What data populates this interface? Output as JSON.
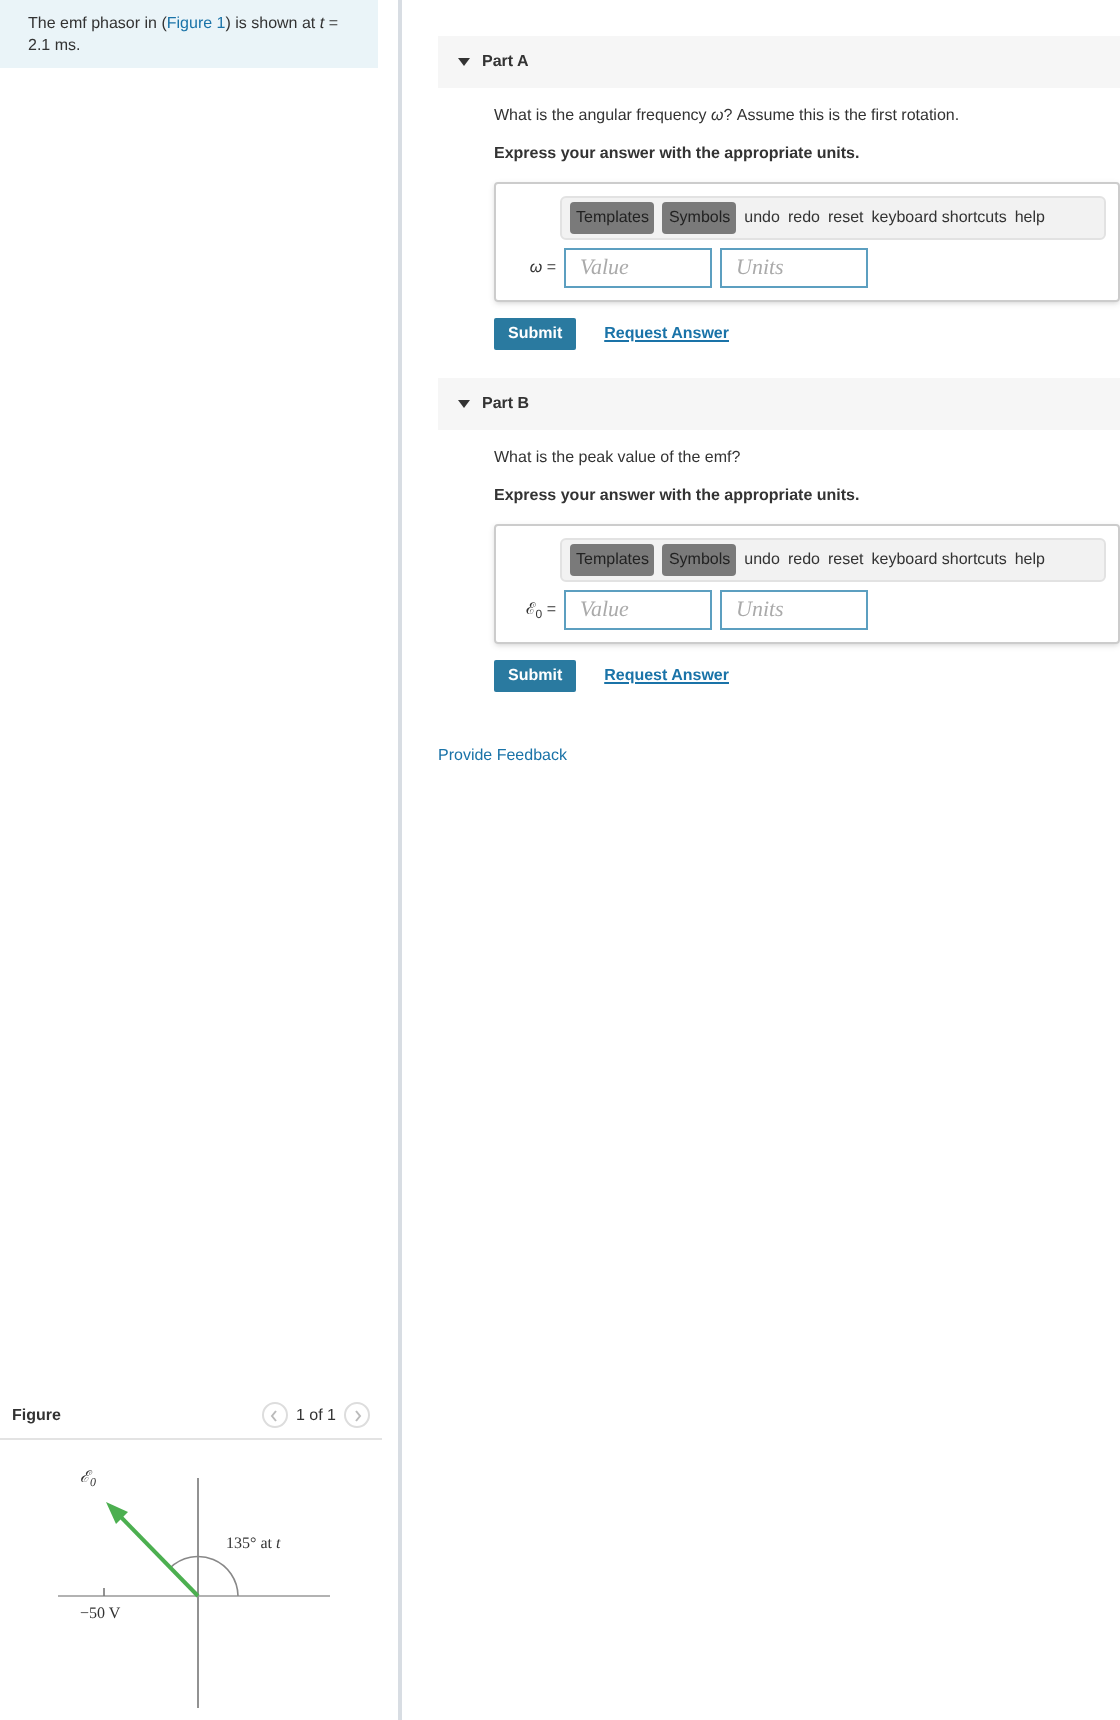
{
  "intro": {
    "before": "The emf phasor in (",
    "link": "Figure 1",
    "after": ") is shown at *t* = 2.1 ms."
  },
  "figure": {
    "title": "Figure",
    "pager": "1 of 1",
    "vector_label": "ℰ$_{0}$",
    "angle_label": "135° at *t*",
    "tick_label": "−50 V"
  },
  "parts": [
    {
      "title": "Part A",
      "expanded": true,
      "question": "What is the angular frequency *ω*? Assume this is the first rotation.",
      "instruction": "Express your answer with the appropriate units.",
      "variable": "*ω* =",
      "value_placeholder": "Value",
      "units_placeholder": "Units",
      "submit": "Submit",
      "request": "Request Answer",
      "toolbar": [
        {
          "kind": "menu",
          "label": "Templates"
        },
        {
          "kind": "menu",
          "label": "Symbols"
        },
        {
          "kind": "action",
          "label": "undo"
        },
        {
          "kind": "action",
          "label": "redo"
        },
        {
          "kind": "action",
          "label": "reset"
        },
        {
          "kind": "action",
          "label": "keyboard shortcuts"
        },
        {
          "kind": "action",
          "label": "help"
        }
      ]
    },
    {
      "title": "Part B",
      "expanded": true,
      "question": "What is the peak value of the emf?",
      "instruction": "Express your answer with the appropriate units.",
      "variable": "ℰ$_{0}$ =",
      "value_placeholder": "Value",
      "units_placeholder": "Units",
      "submit": "Submit",
      "request": "Request Answer",
      "toolbar": [
        {
          "kind": "menu",
          "label": "Templates"
        },
        {
          "kind": "menu",
          "label": "Symbols"
        },
        {
          "kind": "action",
          "label": "undo"
        },
        {
          "kind": "action",
          "label": "redo"
        },
        {
          "kind": "action",
          "label": "reset"
        },
        {
          "kind": "action",
          "label": "keyboard shortcuts"
        },
        {
          "kind": "action",
          "label": "help"
        }
      ]
    }
  ],
  "feedback": "Provide Feedback"
}
